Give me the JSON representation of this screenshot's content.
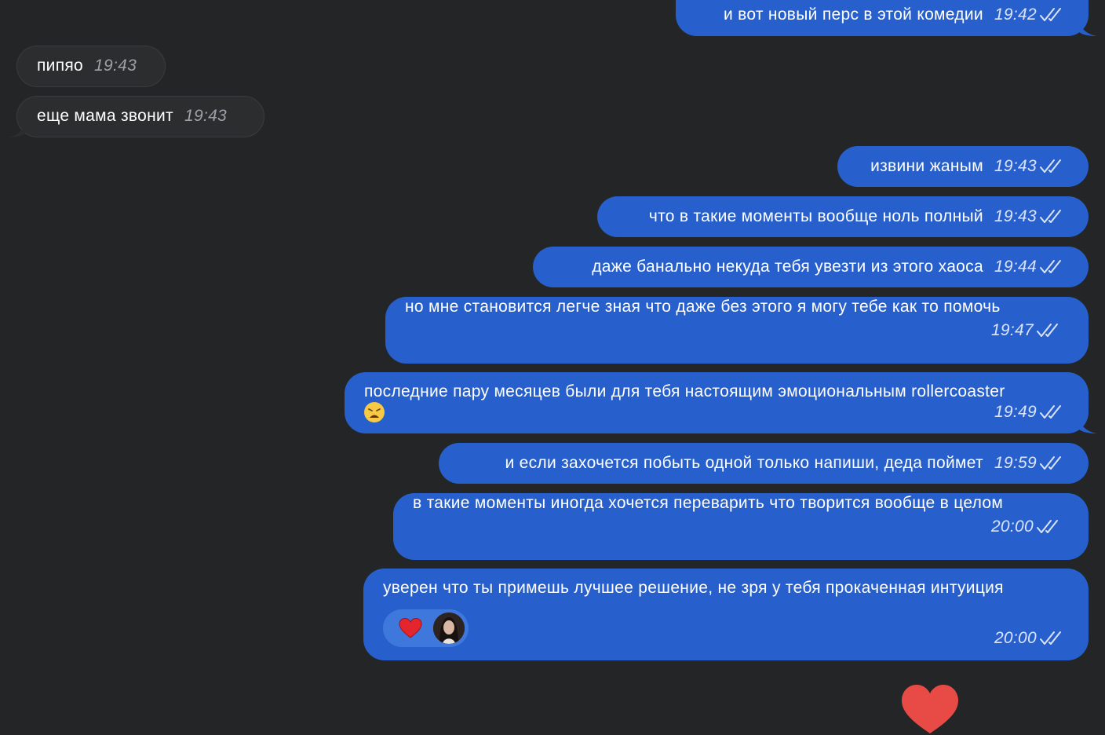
{
  "messages": [
    {
      "dir": "out",
      "text": "и вот новый перс в этой комедии",
      "time": "19:42"
    },
    {
      "dir": "in",
      "text": "пипяо",
      "time": "19:43"
    },
    {
      "dir": "in",
      "text": "еще мама звонит",
      "time": "19:43"
    },
    {
      "dir": "out",
      "text": "извини жаным",
      "time": "19:43"
    },
    {
      "dir": "out",
      "text": "что в такие моменты вообще ноль полный",
      "time": "19:43"
    },
    {
      "dir": "out",
      "text": "даже банально некуда тебя увезти из этого хаоса",
      "time": "19:44"
    },
    {
      "dir": "out",
      "text": "но мне становится легче зная что даже без этого я могу тебе как то помочь",
      "time": "19:47"
    },
    {
      "dir": "out",
      "text": "последние пару месяцев были для тебя настоящим эмоциональным rollercoaster",
      "emoji": "weary-face",
      "time": "19:49"
    },
    {
      "dir": "out",
      "text": "и если захочется побыть одной только напиши, деда поймет",
      "time": "19:59"
    },
    {
      "dir": "out",
      "text": "в такие моменты иногда хочется переварить что творится вообще в целом",
      "time": "20:00"
    },
    {
      "dir": "out",
      "text": "уверен что ты примешь лучшее решение, не зря у тебя прокаченная интуиция",
      "time": "20:00",
      "reaction": {
        "emoji": "red-heart",
        "avatar": "reactor-avatar"
      }
    }
  ],
  "colors": {
    "background": "#232527",
    "outgoing_bubble": "#2760cc",
    "incoming_bubble": "#2c2d2f",
    "floating_heart": "#e84b46"
  }
}
